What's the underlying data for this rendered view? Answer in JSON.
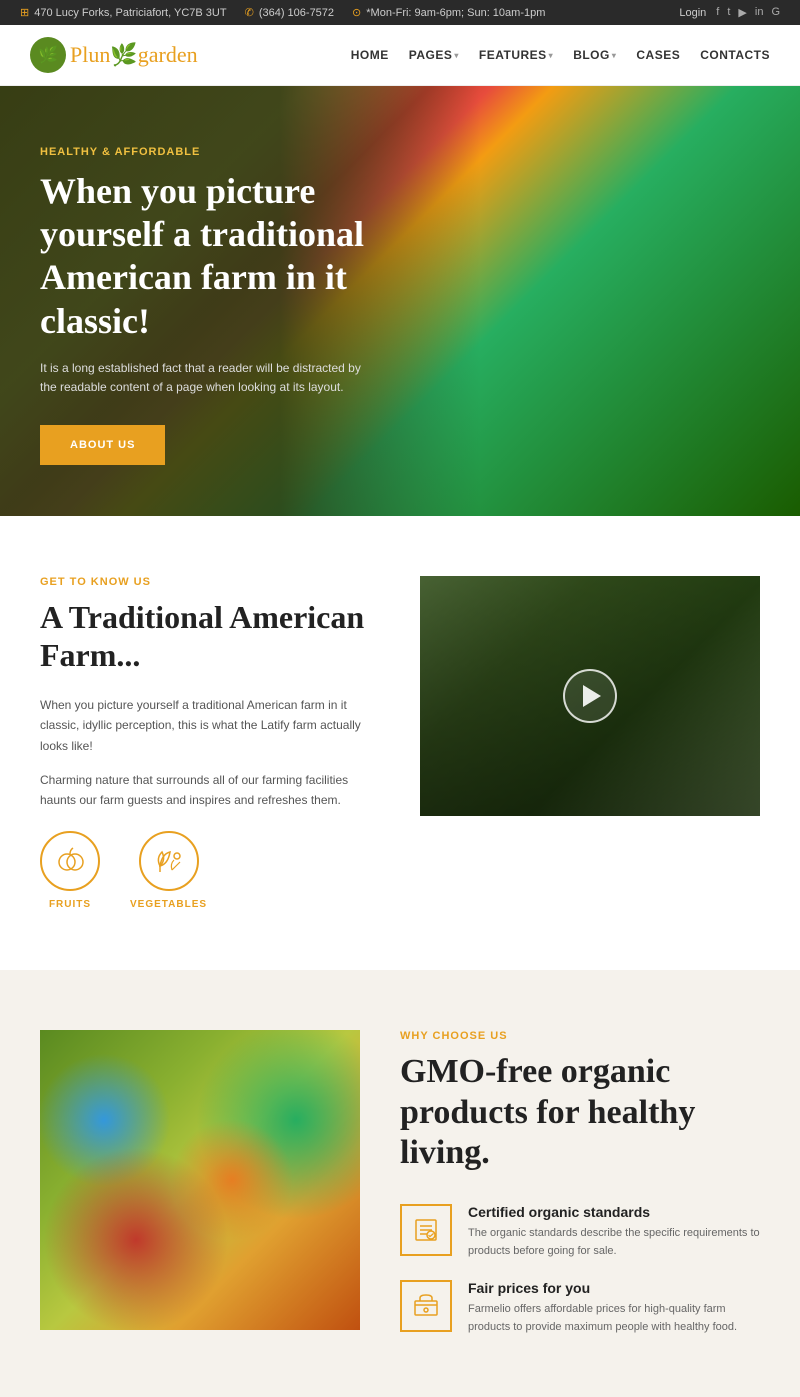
{
  "topbar": {
    "address": "470 Lucy Forks, Patriciafort, YC7B 3UT",
    "phone": "(364) 106-7572",
    "hours": "*Mon-Fri: 9am-6pm; Sun: 10am-1pm",
    "login": "Login"
  },
  "header": {
    "logo_first": "Plun",
    "logo_second": "garden",
    "logo_icon": "🌿",
    "nav": {
      "home": "HOME",
      "pages": "PAGES",
      "features": "FEATURES",
      "blog": "BLOG",
      "cases": "CASES",
      "contacts": "CONTACTS"
    }
  },
  "hero": {
    "subtitle": "Healthy & Affordable",
    "title": "When you picture yourself a traditional American farm in it classic!",
    "description": "It is a long established fact that a reader will be distracted by the readable content of a page when looking at its layout.",
    "cta": "ABOUT US"
  },
  "section_know": {
    "label": "Get to Know Us",
    "title": "A Traditional American Farm...",
    "body1": "When you picture yourself a traditional American farm in it classic, idyllic perception, this is what the Latify farm actually looks like!",
    "body2": "Charming nature that surrounds all of our farming facilities haunts our farm guests and inspires and refreshes them.",
    "fruits_label": "FRUITS",
    "vegetables_label": "VEGETABLES"
  },
  "section_why": {
    "label": "Why Choose Us",
    "title": "GMO-free organic products for healthy living.",
    "items": [
      {
        "title": "Certified organic standards",
        "desc": "The organic standards describe the specific requirements to products before going for sale."
      },
      {
        "title": "Fair prices for you",
        "desc": "Farmelio offers affordable prices for high-quality farm products to provide maximum people with healthy food."
      }
    ]
  }
}
